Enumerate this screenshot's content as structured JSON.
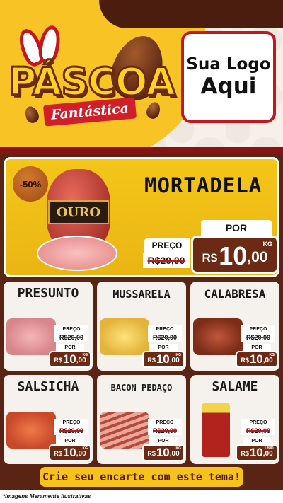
{
  "header": {
    "title": "PÁSCOA",
    "subtitle": "Fantástica",
    "logo_line1": "Sua Logo",
    "logo_line2": "Aqui"
  },
  "featured": {
    "discount": "-50%",
    "brand": "OURO",
    "name": "MORTADELA",
    "preco_label": "PREÇO",
    "old_price": "R$20,00",
    "por_label": "POR",
    "currency": "R$",
    "price_int": "10",
    "price_dec": ",00",
    "unit": "KG"
  },
  "products": [
    {
      "name": "PRESUNTO",
      "preco_label": "PREÇO",
      "old_price": "R$20,00",
      "por_label": "POR",
      "currency": "R$",
      "price_int": "10",
      "price_dec": ",00",
      "unit": "KG"
    },
    {
      "name": "MUSSARELA",
      "preco_label": "PREÇO",
      "old_price": "R$20,00",
      "por_label": "POR",
      "currency": "R$",
      "price_int": "10",
      "price_dec": ",00",
      "unit": "KG"
    },
    {
      "name": "CALABRESA",
      "preco_label": "PREÇO",
      "old_price": "R$20,00",
      "por_label": "POR",
      "currency": "R$",
      "price_int": "10",
      "price_dec": ",00",
      "unit": "KG"
    },
    {
      "name": "SALSICHA",
      "preco_label": "PREÇO",
      "old_price": "R$20,00",
      "por_label": "POR",
      "currency": "R$",
      "price_int": "10",
      "price_dec": ",00",
      "unit": "KG"
    },
    {
      "name": "BACON PEDAÇO",
      "preco_label": "PREÇO",
      "old_price": "R$20,00",
      "por_label": "POR",
      "currency": "R$",
      "price_int": "10",
      "price_dec": ",00",
      "unit": "KG"
    },
    {
      "name": "SALAME",
      "preco_label": "PREÇO",
      "old_price": "R$20,00",
      "por_label": "POR",
      "currency": "R$",
      "price_int": "10",
      "price_dec": ",00",
      "unit": "UNID."
    }
  ],
  "footer": {
    "cta": "Crie seu encarte com este tema!",
    "disclaimer": "*Imagens Meramente Ilustrativas"
  },
  "colors": {
    "brown": "#5a2414",
    "yellow": "#f4c619",
    "red": "#c4161c",
    "cream": "#f5f1ec"
  }
}
